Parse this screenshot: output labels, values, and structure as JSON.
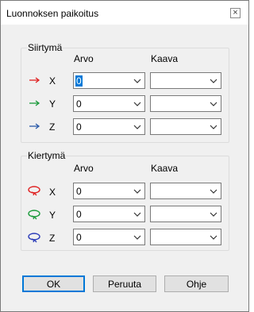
{
  "dialog": {
    "title": "Luonnoksen paikoitus",
    "close_glyph": "×"
  },
  "translation": {
    "label": "Siirtymä",
    "col_value": "Arvo",
    "col_formula": "Kaava",
    "rows": [
      {
        "axis": "X",
        "value": "0",
        "formula": "",
        "color": "#e02020",
        "icon": "arrow-right-icon"
      },
      {
        "axis": "Y",
        "value": "0",
        "formula": "",
        "color": "#1a9a3a",
        "icon": "arrow-right-icon"
      },
      {
        "axis": "Z",
        "value": "0",
        "formula": "",
        "color": "#2a5aa8",
        "icon": "arrow-right-icon"
      }
    ]
  },
  "rotation": {
    "label": "Kiertymä",
    "col_value": "Arvo",
    "col_formula": "Kaava",
    "rows": [
      {
        "axis": "X",
        "value": "0",
        "formula": "",
        "color": "#e02020",
        "icon": "rotate-icon"
      },
      {
        "axis": "Y",
        "value": "0",
        "formula": "",
        "color": "#1a9a3a",
        "icon": "rotate-icon"
      },
      {
        "axis": "Z",
        "value": "0",
        "formula": "",
        "color": "#2a3ab8",
        "icon": "rotate-icon"
      }
    ]
  },
  "buttons": {
    "ok": "OK",
    "cancel": "Peruuta",
    "help": "Ohje"
  }
}
